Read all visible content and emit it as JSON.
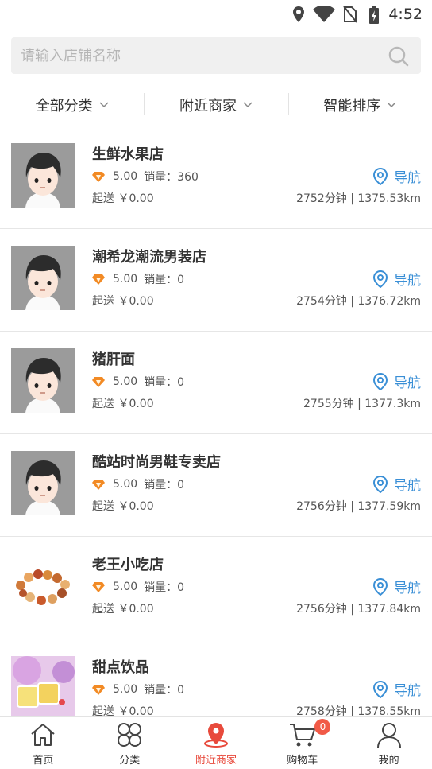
{
  "status_bar": {
    "time": "4:52"
  },
  "search": {
    "placeholder": "请输入店铺名称"
  },
  "filters": [
    {
      "label": "全部分类"
    },
    {
      "label": "附近商家"
    },
    {
      "label": "智能排序"
    }
  ],
  "stores": [
    {
      "name": "生鲜水果店",
      "rating": "5.00",
      "sales": "销量：360",
      "min_order": "起送 ￥0.00",
      "nav_label": "导航",
      "distance": "2752分钟 | 1375.53km",
      "thumb": "avatar"
    },
    {
      "name": "潮希龙潮流男装店",
      "rating": "5.00",
      "sales": "销量：0",
      "min_order": "起送 ￥0.00",
      "nav_label": "导航",
      "distance": "2754分钟 | 1376.72km",
      "thumb": "avatar"
    },
    {
      "name": "猪肝面",
      "rating": "5.00",
      "sales": "销量：0",
      "min_order": "起送 ￥0.00",
      "nav_label": "导航",
      "distance": "2755分钟 | 1377.3km",
      "thumb": "avatar"
    },
    {
      "name": "酷站时尚男鞋专卖店",
      "rating": "5.00",
      "sales": "销量：0",
      "min_order": "起送 ￥0.00",
      "nav_label": "导航",
      "distance": "2756分钟 | 1377.59km",
      "thumb": "avatar"
    },
    {
      "name": "老王小吃店",
      "rating": "5.00",
      "sales": "销量：0",
      "min_order": "起送 ￥0.00",
      "nav_label": "导航",
      "distance": "2756分钟 | 1377.84km",
      "thumb": "snacks"
    },
    {
      "name": "甜点饮品",
      "rating": "5.00",
      "sales": "销量：0",
      "min_order": "起送 ￥0.00",
      "nav_label": "导航",
      "distance": "2758分钟 | 1378.55km",
      "thumb": "dessert"
    }
  ],
  "tabs": [
    {
      "label": "首页",
      "icon": "home-icon"
    },
    {
      "label": "分类",
      "icon": "category-icon"
    },
    {
      "label": "附近商家",
      "icon": "location-pin-icon"
    },
    {
      "label": "购物车",
      "icon": "cart-icon",
      "badge": "0"
    },
    {
      "label": "我的",
      "icon": "user-icon"
    }
  ],
  "colors": {
    "accent": "#e84a3c",
    "nav_blue": "#3a8fd6",
    "badge": "#f15a47"
  }
}
